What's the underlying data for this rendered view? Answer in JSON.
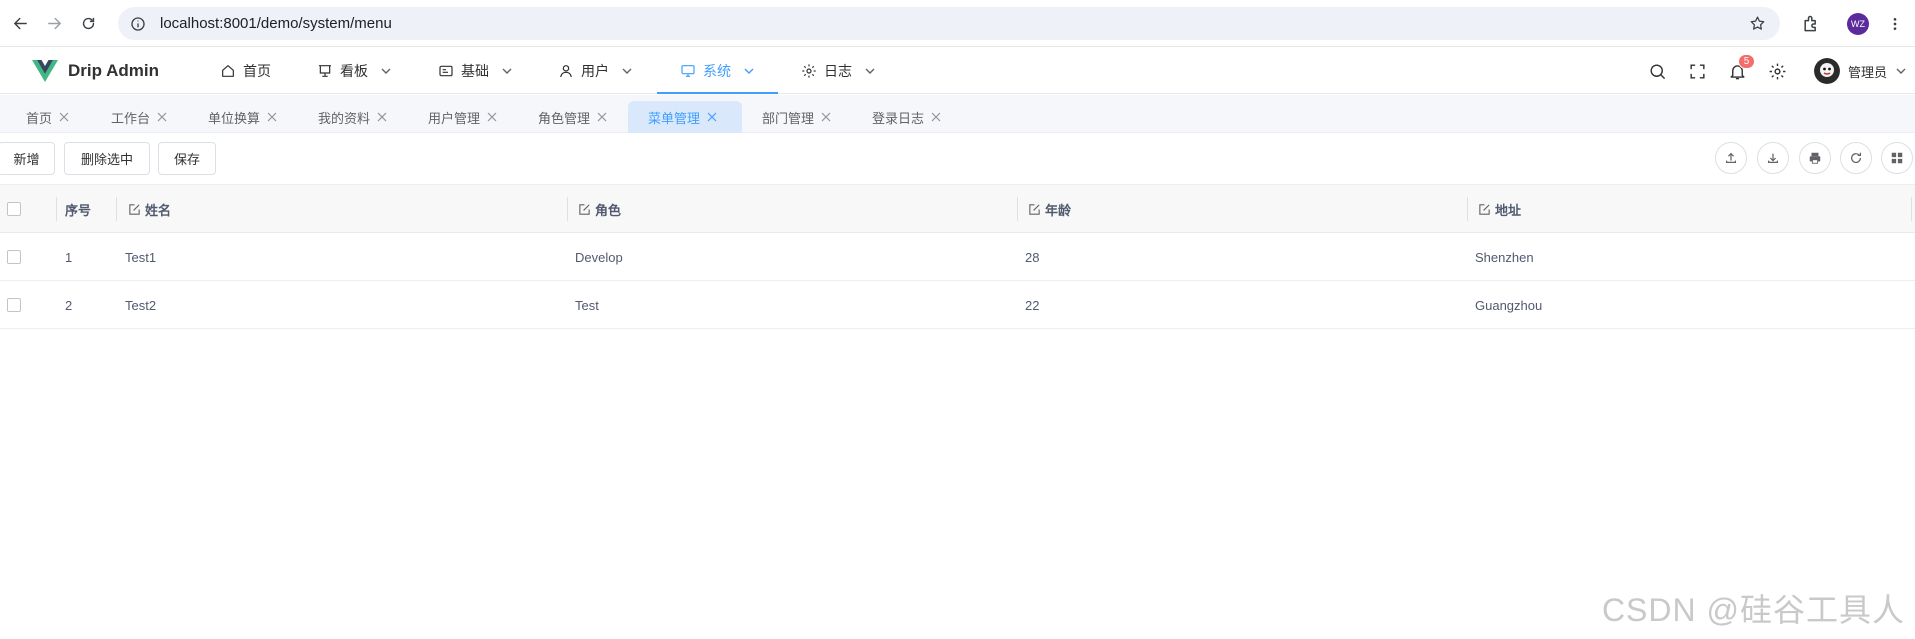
{
  "browser": {
    "url": "localhost:8001/demo/system/menu",
    "profile_initials": "WZ"
  },
  "app": {
    "name": "Drip Admin",
    "brand_color": "#41b883",
    "accent_color": "#409eff"
  },
  "menu": [
    {
      "label": "首页",
      "icon": "home-icon",
      "has_dropdown": false
    },
    {
      "label": "看板",
      "icon": "presentation-board-icon",
      "has_dropdown": true
    },
    {
      "label": "基础",
      "icon": "id-card-icon",
      "has_dropdown": true
    },
    {
      "label": "用户",
      "icon": "user-icon",
      "has_dropdown": true
    },
    {
      "label": "系统",
      "icon": "monitor-icon",
      "has_dropdown": true,
      "active": true
    },
    {
      "label": "日志",
      "icon": "gear-icon",
      "has_dropdown": true
    }
  ],
  "header_right": {
    "notification_count": "5",
    "user_name": "管理员"
  },
  "tabs": [
    {
      "label": "首页"
    },
    {
      "label": "工作台"
    },
    {
      "label": "单位换算"
    },
    {
      "label": "我的资料"
    },
    {
      "label": "用户管理"
    },
    {
      "label": "角色管理"
    },
    {
      "label": "菜单管理",
      "active": true
    },
    {
      "label": "部门管理"
    },
    {
      "label": "登录日志"
    }
  ],
  "toolbar": {
    "add_label": "新增",
    "delete_label": "删除选中",
    "save_label": "保存",
    "tools": [
      "upload-icon",
      "download-icon",
      "print-icon",
      "refresh-icon",
      "columns-icon"
    ]
  },
  "table": {
    "columns": [
      "序号",
      "姓名",
      "角色",
      "年龄",
      "地址"
    ],
    "rows": [
      {
        "seq": "1",
        "name": "Test1",
        "role": "Develop",
        "age": "28",
        "address": "Shenzhen"
      },
      {
        "seq": "2",
        "name": "Test2",
        "role": "Test",
        "age": "22",
        "address": "Guangzhou"
      }
    ]
  },
  "watermark": "CSDN @硅谷工具人"
}
